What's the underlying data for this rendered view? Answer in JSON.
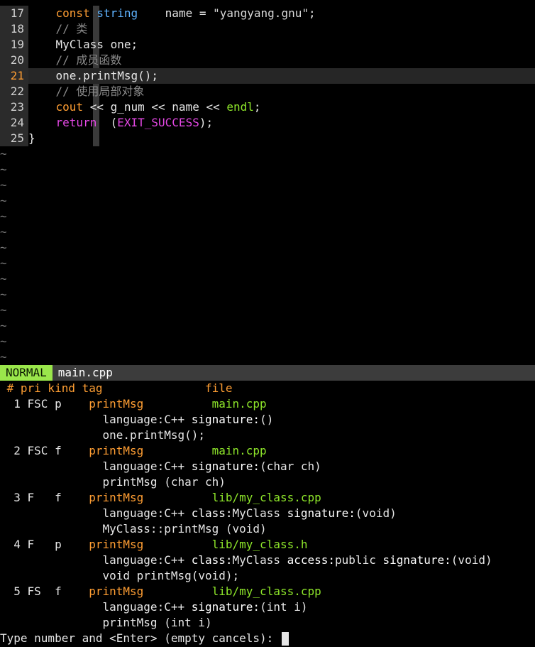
{
  "editor": {
    "lines": [
      {
        "num": "17",
        "seg": [
          [
            "",
            "    "
          ],
          [
            "kw",
            "const"
          ],
          [
            "",
            "",
            " "
          ],
          [
            "type",
            "string"
          ],
          [
            "",
            "    name = "
          ],
          [
            "str",
            "\"yangyang.gnu\""
          ],
          [
            "",
            ";"
          ]
        ]
      },
      {
        "num": "18",
        "seg": [
          [
            "",
            "    "
          ],
          [
            "comment",
            "// 类"
          ]
        ]
      },
      {
        "num": "19",
        "seg": [
          [
            "",
            "    MyClass one;"
          ]
        ]
      },
      {
        "num": "20",
        "seg": [
          [
            "",
            "    "
          ],
          [
            "comment",
            "// 成员函数"
          ]
        ]
      },
      {
        "num": "21",
        "current": true,
        "seg": [
          [
            "",
            "    one.printMsg();"
          ]
        ]
      },
      {
        "num": "22",
        "seg": [
          [
            "",
            "    "
          ],
          [
            "comment",
            "// 使用局部对象"
          ]
        ]
      },
      {
        "num": "23",
        "seg": [
          [
            "",
            "    "
          ],
          [
            "kw",
            "cout"
          ],
          [
            "",
            " << g_num << name << "
          ],
          [
            "green",
            "endl"
          ],
          [
            "",
            ";"
          ]
        ]
      },
      {
        "num": "24",
        "seg": [
          [
            "",
            "    "
          ],
          [
            "mag",
            "return"
          ],
          [
            "",
            "  ("
          ],
          [
            "mag",
            "EXIT_SUCCESS"
          ],
          [
            "",
            ");"
          ]
        ]
      },
      {
        "num": "25",
        "seg": [
          [
            "",
            "}"
          ]
        ]
      }
    ],
    "tilde": "~",
    "tilde_count": 14
  },
  "statusline": {
    "mode": "NORMAL",
    "filename": "main.cpp"
  },
  "taglist": {
    "header": {
      "num": "#",
      "pri": "pri",
      "kind": "kind",
      "tag": "tag",
      "file": "file"
    },
    "entries": [
      {
        "num": "1",
        "pri": "FSC",
        "kind": "p",
        "tag": "printMsg",
        "file": "main.cpp",
        "detail": [
          [
            "",
            "language:C++ "
          ],
          [
            "white",
            "signature:"
          ],
          [
            "",
            "()"
          ]
        ],
        "source": "one.printMsg();"
      },
      {
        "num": "2",
        "pri": "FSC",
        "kind": "f",
        "tag": "printMsg",
        "file": "main.cpp",
        "detail": [
          [
            "",
            "language:C++ "
          ],
          [
            "white",
            "signature:"
          ],
          [
            "",
            "(char ch)"
          ]
        ],
        "source": "printMsg (char ch)"
      },
      {
        "num": "3",
        "pri": "F",
        "kind": "f",
        "tag": "printMsg",
        "file": "lib/my_class.cpp",
        "detail": [
          [
            "",
            "language:C++ "
          ],
          [
            "white",
            "class:"
          ],
          [
            "",
            "MyClass "
          ],
          [
            "white",
            "signature:"
          ],
          [
            "",
            "(void)"
          ]
        ],
        "source": "MyClass::printMsg (void)"
      },
      {
        "num": "4",
        "pri": "F",
        "kind": "p",
        "tag": "printMsg",
        "file": "lib/my_class.h",
        "detail": [
          [
            "",
            "language:C++ "
          ],
          [
            "white",
            "class:"
          ],
          [
            "",
            "MyClass "
          ],
          [
            "white",
            "access:"
          ],
          [
            "",
            "public "
          ],
          [
            "white",
            "signature:"
          ],
          [
            "",
            "(void)"
          ]
        ],
        "source": "void printMsg(void);"
      },
      {
        "num": "5",
        "pri": "FS",
        "kind": "f",
        "tag": "printMsg",
        "file": "lib/my_class.cpp",
        "detail": [
          [
            "",
            "language:C++ "
          ],
          [
            "white",
            "signature:"
          ],
          [
            "",
            "(int i)"
          ]
        ],
        "source": "printMsg (int i)"
      }
    ]
  },
  "prompt": {
    "text": "Type number and <Enter> (empty cancels): "
  },
  "colors": {
    "mode_bg": "#9ae64b",
    "keyword": "#ff9e33",
    "type": "#5fb3ff",
    "file": "#8ee62a",
    "magenta": "#e548e5"
  }
}
